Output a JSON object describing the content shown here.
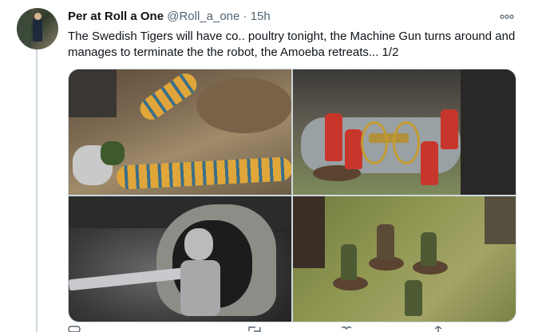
{
  "tweet": {
    "author_name": "Per at Roll a One",
    "author_handle": "@Roll_a_one",
    "separator": "·",
    "timestamp": "15h",
    "more_icon": "more-horizontal-icon",
    "text": "The Swedish Tigers will have co.. poultry tonight, the Machine Gun turns around and manages to terminate the the robot, the Amoeba retreats... 1/2",
    "media": [
      {
        "subject": "tiger-miniature-photo"
      },
      {
        "subject": "red-soldiers-with-gun-photo"
      },
      {
        "subject": "robot-in-cave-photo"
      },
      {
        "subject": "green-soldiers-photo"
      }
    ],
    "actions": [
      "reply-icon",
      "retweet-icon",
      "like-icon",
      "share-icon"
    ]
  },
  "colors": {
    "text": "#0f1419",
    "secondary": "#536471",
    "border": "#cfd9de"
  }
}
